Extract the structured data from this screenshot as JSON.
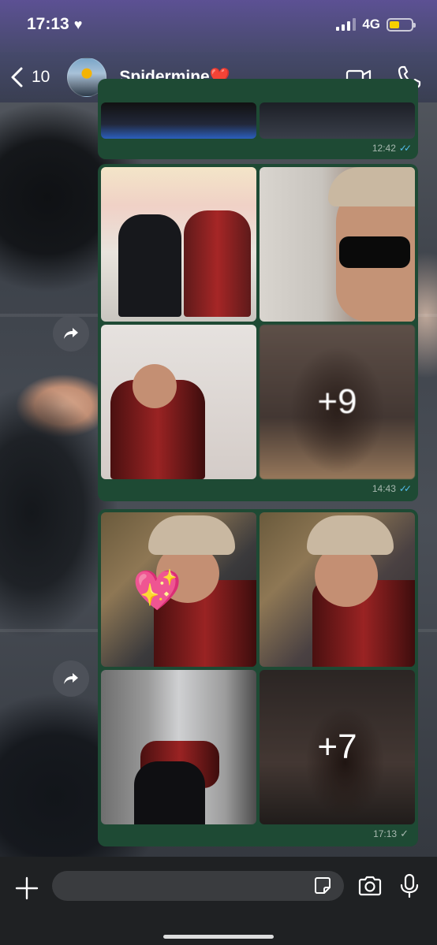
{
  "status_bar": {
    "time": "17:13",
    "network": "4G",
    "heart_icon": "heart-icon",
    "battery_level": 0.45
  },
  "header": {
    "back_count": "10",
    "contact_name": "Spidermine❤️",
    "icons": [
      "chevron-left-icon",
      "video-call-icon",
      "phone-icon"
    ]
  },
  "messages": [
    {
      "time": "12:42",
      "status": "read",
      "ticks": "✓✓"
    },
    {
      "time": "14:43",
      "status": "read",
      "ticks": "✓✓",
      "more_count": "+9"
    },
    {
      "time": "17:13",
      "status": "sent",
      "ticks": "✓",
      "more_count": "+7"
    }
  ],
  "input": {
    "placeholder": "",
    "icons": [
      "plus-icon",
      "sticker-icon",
      "camera-icon",
      "microphone-icon"
    ]
  },
  "colors": {
    "bubble": "#1e4a34",
    "read_ticks": "#53bdeb",
    "battery": "#f6d000"
  }
}
